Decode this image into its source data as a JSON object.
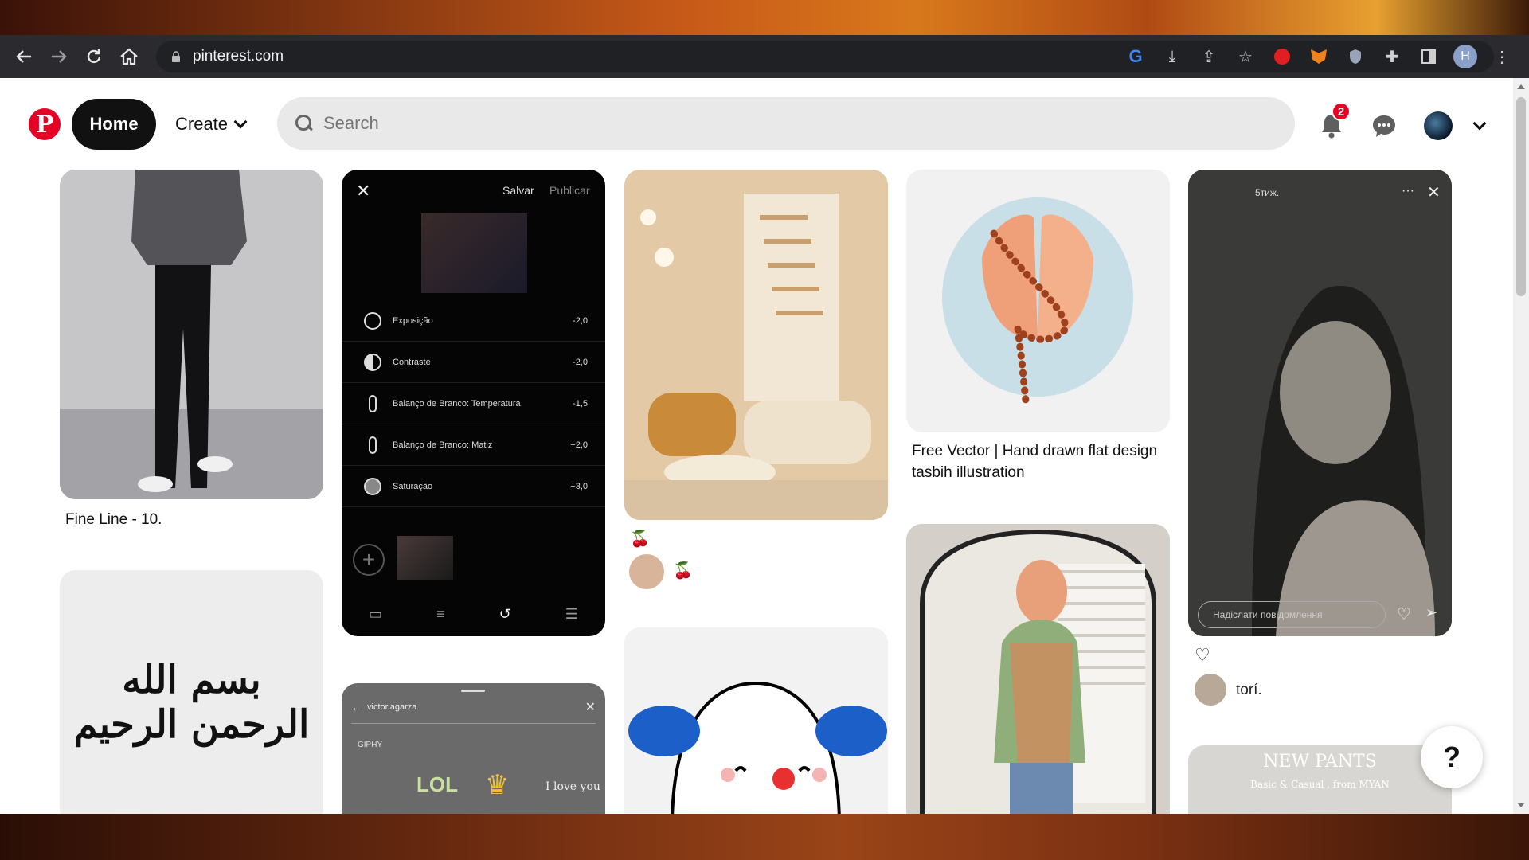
{
  "browser": {
    "url": "pinterest.com",
    "profile_initial": "H"
  },
  "header": {
    "logo": "P",
    "home_label": "Home",
    "create_label": "Create",
    "search_placeholder": "Search",
    "notifications_count": "2"
  },
  "pins": {
    "fine_line": {
      "title": "Fine Line - 10."
    },
    "edit_screen": {
      "save": "Salvar",
      "publish": "Publicar",
      "rows": [
        {
          "label": "Exposição",
          "value": "-2,0"
        },
        {
          "label": "Contraste",
          "value": "-2,0"
        },
        {
          "label": "Balanço de Branco: Temperatura",
          "value": "-1,5"
        },
        {
          "label": "Balanço de Branco: Matiz",
          "value": "+2,0"
        },
        {
          "label": "Saturação",
          "value": "+3,0"
        }
      ]
    },
    "story": {
      "user": "victoriagarza",
      "giphy": "GIPHY",
      "sticker_lol": "LOL",
      "sticker_love": "I love you"
    },
    "interior": {
      "emoji": "🍒",
      "emoji2": "🍒"
    },
    "tasbih": {
      "title": "Free Vector | Hand drawn flat design tasbih illustration"
    },
    "portrait": {
      "time_ago": "5тиж.",
      "reply_placeholder": "Надіслати повідомлення",
      "author": "torí."
    },
    "new_pants": {
      "title": "NEW PANTS",
      "subtitle": "Basic & Casual , from MYAN"
    },
    "calligraphy": {
      "text": "بسم الله الرحمن الرحيم"
    }
  },
  "help_label": "?",
  "colors": {
    "brand": "#e60023",
    "home_bg": "#111111",
    "search_bg": "#e9e9e9"
  }
}
